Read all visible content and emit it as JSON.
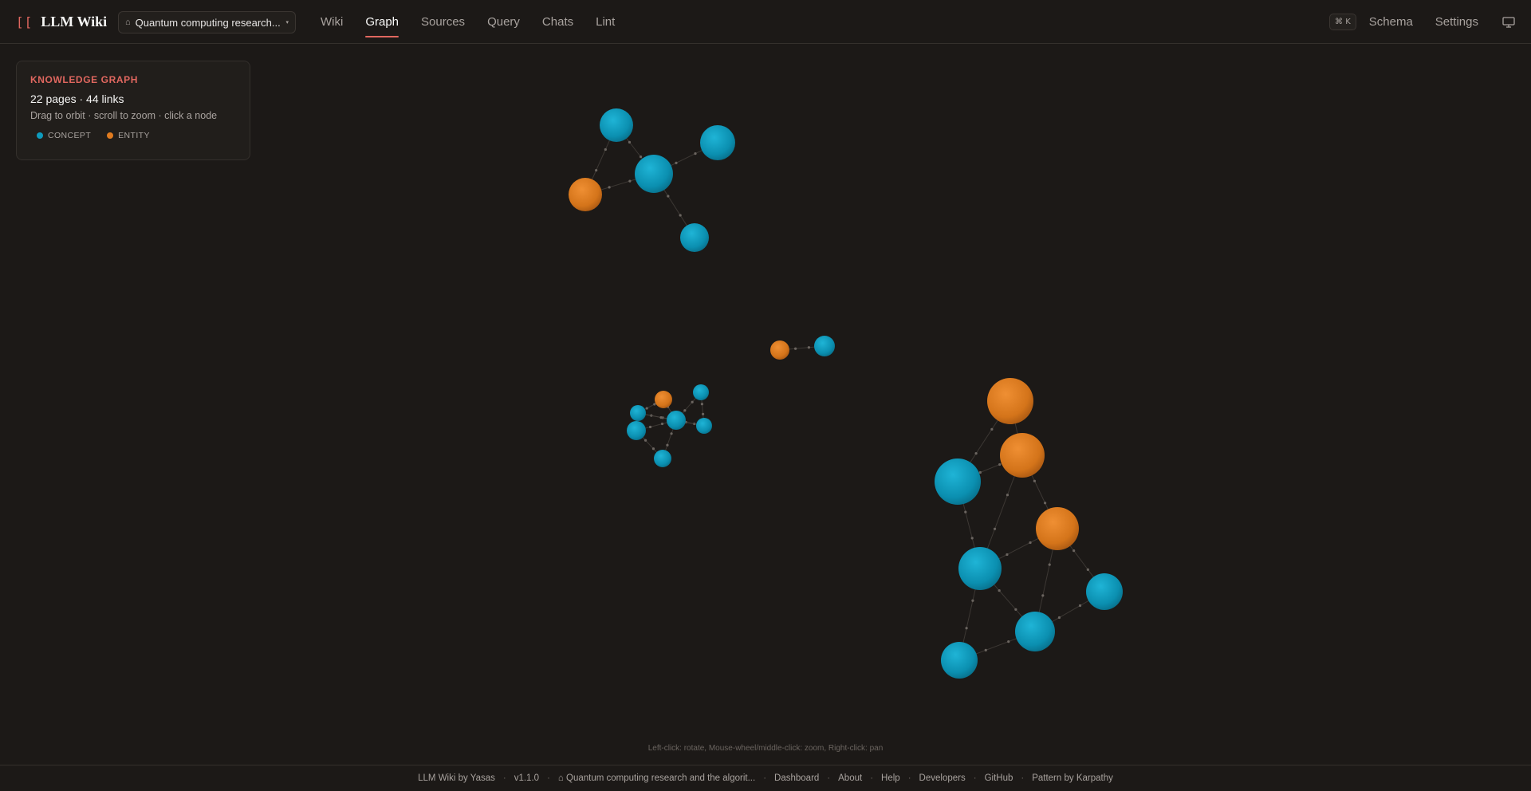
{
  "app": {
    "logo_mark": "[[",
    "name": "LLM Wiki"
  },
  "project": {
    "icon": "home-icon",
    "label": "Quantum computing research...",
    "caret": "▾"
  },
  "nav": {
    "items": [
      {
        "label": "Wiki"
      },
      {
        "label": "Graph",
        "active": true
      },
      {
        "label": "Sources"
      },
      {
        "label": "Query"
      },
      {
        "label": "Chats"
      },
      {
        "label": "Lint"
      }
    ]
  },
  "toolbar": {
    "shortcut": "⌘ K",
    "schema": "Schema",
    "settings": "Settings",
    "display_icon": "monitor-icon"
  },
  "kg": {
    "title": "KNOWLEDGE GRAPH",
    "stats": "22 pages · 44 links",
    "help": "Drag to orbit · scroll to zoom · click a node",
    "legend": [
      {
        "label": "CONCEPT",
        "color": "#0e9bbd"
      },
      {
        "label": "ENTITY",
        "color": "#e07b1f"
      }
    ]
  },
  "graph": {
    "hint": "Left-click: rotate, Mouse-wheel/middle-click: zoom, Right-click: pan",
    "colors": {
      "concept": "#0e9bbd",
      "entity": "#e07b1f",
      "link": "#4a4540"
    }
  },
  "footer": {
    "items": [
      "LLM Wiki by Yasas",
      "v1.1.0",
      "⌂ Quantum computing research and the algorit...",
      "Dashboard",
      "About",
      "Help",
      "Developers",
      "GitHub",
      "Pattern by Karpathy"
    ]
  }
}
